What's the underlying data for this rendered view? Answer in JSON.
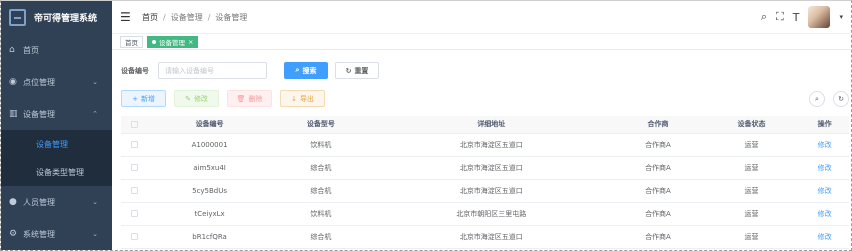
{
  "app": {
    "title": "帝可得管理系统"
  },
  "sidebar": {
    "items": [
      {
        "label": "首页",
        "icon": "dashboard-icon"
      },
      {
        "label": "点位管理",
        "icon": "location-icon"
      },
      {
        "label": "设备管理",
        "icon": "device-icon"
      },
      {
        "label": "人员管理",
        "icon": "user-icon"
      },
      {
        "label": "系统管理",
        "icon": "settings-icon"
      }
    ],
    "submenu": [
      {
        "label": "设备管理"
      },
      {
        "label": "设备类型管理"
      }
    ]
  },
  "breadcrumb": {
    "items": [
      "首页",
      "设备管理",
      "设备管理"
    ],
    "sep": "/"
  },
  "tabs": [
    {
      "label": "首页"
    },
    {
      "label": "设备管理"
    }
  ],
  "search": {
    "label": "设备编号",
    "placeholder": "请输入设备编号",
    "search_button": "搜索",
    "reset_button": "重置"
  },
  "toolbar": {
    "add": "新增",
    "edit": "修改",
    "delete": "删除",
    "export": "导出"
  },
  "table": {
    "headers": [
      "设备编号",
      "设备型号",
      "详细地址",
      "合作商",
      "设备状态",
      "操作"
    ],
    "rows": [
      {
        "code": "A1000001",
        "type": "饮料机",
        "address": "北京市海淀区五道口",
        "partner": "合作商A",
        "status": "运营",
        "op": "修改"
      },
      {
        "code": "aim5xu4I",
        "type": "综合机",
        "address": "北京市海淀区五道口",
        "partner": "合作商A",
        "status": "运营",
        "op": "修改"
      },
      {
        "code": "5cy5BdUs",
        "type": "综合机",
        "address": "北京市海淀区五道口",
        "partner": "合作商A",
        "status": "运营",
        "op": "修改"
      },
      {
        "code": "tCeiyxLx",
        "type": "饮料机",
        "address": "北京市朝阳区三里屯路",
        "partner": "合作商A",
        "status": "运营",
        "op": "修改"
      },
      {
        "code": "bR1cfQRa",
        "type": "综合机",
        "address": "北京市海淀区五道口",
        "partner": "合作商A",
        "status": "运营",
        "op": "修改"
      }
    ]
  },
  "colors": {
    "sidebar": "#304156",
    "primary": "#409eff",
    "active_tab": "#42b983"
  }
}
